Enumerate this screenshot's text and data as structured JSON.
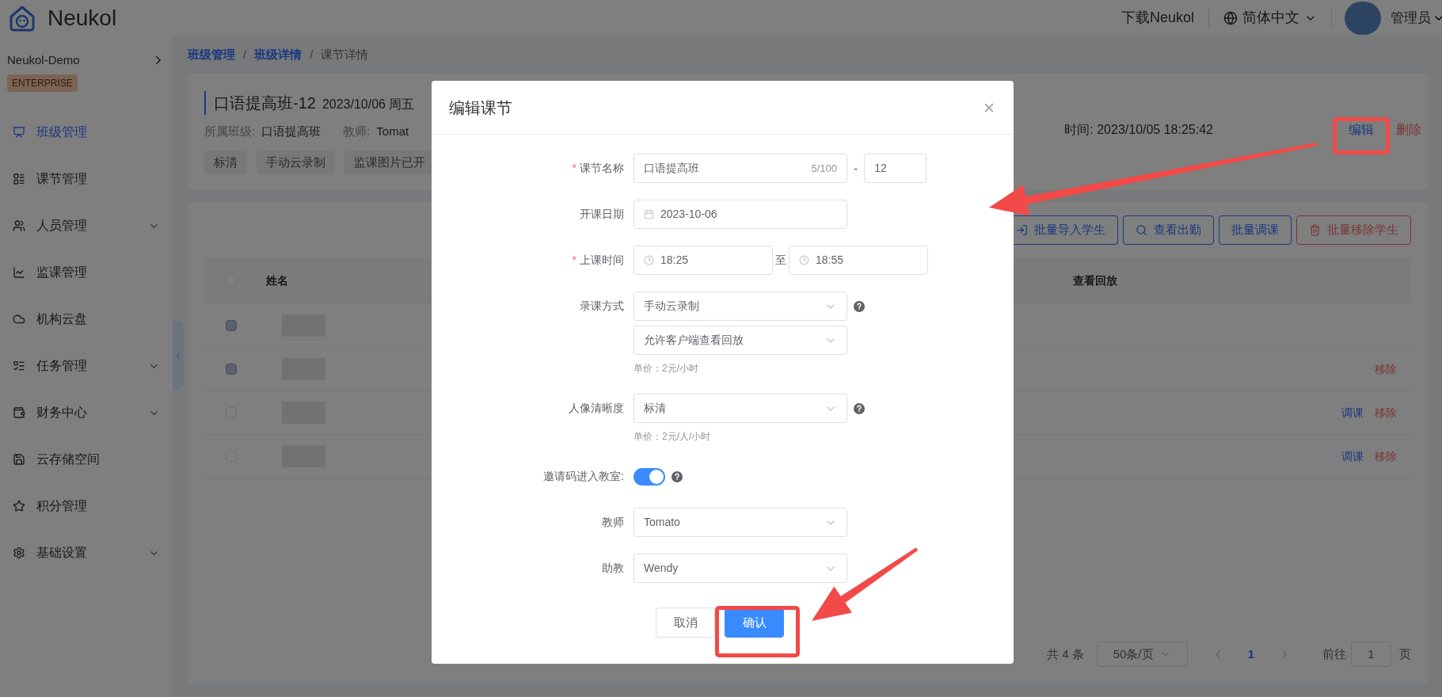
{
  "top_bar": {
    "brand": "Neukol",
    "download": "下载Neukol",
    "language": "简体中文",
    "user": "管理员"
  },
  "sidebar": {
    "org": "Neukol-Demo",
    "badge": "ENTERPRISE",
    "items": [
      {
        "label": "班级管理",
        "selected": true,
        "expandable": false
      },
      {
        "label": "课节管理",
        "selected": false,
        "expandable": false
      },
      {
        "label": "人员管理",
        "selected": false,
        "expandable": true
      },
      {
        "label": "监课管理",
        "selected": false,
        "expandable": false
      },
      {
        "label": "机构云盘",
        "selected": false,
        "expandable": false
      },
      {
        "label": "任务管理",
        "selected": false,
        "expandable": true
      },
      {
        "label": "财务中心",
        "selected": false,
        "expandable": true
      },
      {
        "label": "云存储空间",
        "selected": false,
        "expandable": false
      },
      {
        "label": "积分管理",
        "selected": false,
        "expandable": false
      },
      {
        "label": "基础设置",
        "selected": false,
        "expandable": true
      }
    ]
  },
  "breadcrumb": {
    "separator": "/",
    "items": [
      {
        "label": "班级管理",
        "link": true
      },
      {
        "label": "班级详情",
        "link": true
      },
      {
        "label": "课节详情",
        "link": false
      }
    ]
  },
  "lesson": {
    "title": "口语提高班-12",
    "date": "2023/10/06 周五",
    "meta": [
      {
        "label": "所属班级:",
        "value": "口语提高班"
      },
      {
        "label": "教师:",
        "value": "Tomat"
      }
    ],
    "created": "时间: 2023/10/05 18:25:42",
    "tags": [
      "标清",
      "手动云录制",
      "监课图片已开"
    ],
    "actions": [
      {
        "label": "编辑",
        "kind": "primary"
      },
      {
        "label": "删除",
        "kind": "danger"
      }
    ]
  },
  "toolbar": [
    {
      "label": "批量导入学生",
      "kind": "primary"
    },
    {
      "label": "查看出勤",
      "kind": "primary"
    },
    {
      "label": "批量调课",
      "kind": "primary"
    },
    {
      "label": "批量移除学生",
      "kind": "danger"
    }
  ],
  "table": {
    "select_all_checked": false,
    "columns": [
      "姓名",
      "查看回放"
    ],
    "rows": [
      {
        "disabled": true,
        "actions": []
      },
      {
        "disabled": true,
        "actions": [
          {
            "label": "移除",
            "kind": "danger"
          }
        ]
      },
      {
        "disabled": false,
        "actions": [
          {
            "label": "调课",
            "kind": "primary"
          },
          {
            "label": "移除",
            "kind": "danger"
          }
        ]
      },
      {
        "disabled": false,
        "actions": [
          {
            "label": "调课",
            "kind": "primary"
          },
          {
            "label": "移除",
            "kind": "danger"
          }
        ]
      }
    ]
  },
  "pagination": {
    "total": "共 4 条",
    "page_size": "50条/页",
    "pages": [
      {
        "label": "1",
        "selected": true
      }
    ],
    "goto": "前往",
    "goto_value": "1",
    "suffix": "页"
  },
  "dialog": {
    "title": "编辑课节",
    "required_mark": "*",
    "fields": [
      {
        "kind": "name",
        "label": "课节名称",
        "required": true,
        "help": false,
        "value": "口语提高班",
        "count": "5/100",
        "separator": "-",
        "suffix_value": "12"
      },
      {
        "kind": "date",
        "label": "开课日期",
        "required": false,
        "help": false,
        "value": "2023-10-06"
      },
      {
        "kind": "time_range",
        "label": "上课时间",
        "required": true,
        "help": false,
        "start": "18:25",
        "separator": "至",
        "end": "18:55"
      },
      {
        "kind": "select",
        "label": "录课方式",
        "required": false,
        "help": true,
        "selects": [
          "手动云录制",
          "允许客户端查看回放"
        ],
        "hint": "单价：2元/小时"
      },
      {
        "kind": "select",
        "label": "人像清晰度",
        "required": false,
        "help": true,
        "selects": [
          "标清"
        ],
        "hint": "单价：2元/人/小时"
      },
      {
        "kind": "switch",
        "label": "邀请码进入教室:",
        "required": false,
        "help": true,
        "on": true
      },
      {
        "kind": "select",
        "label": "教师",
        "required": false,
        "help": false,
        "selects": [
          "Tomato"
        ]
      },
      {
        "kind": "select",
        "label": "助教",
        "required": false,
        "help": false,
        "selects": [
          "Wendy"
        ]
      }
    ],
    "buttons": [
      {
        "label": "取消",
        "kind": "default"
      },
      {
        "label": "确认",
        "kind": "primary"
      }
    ]
  }
}
